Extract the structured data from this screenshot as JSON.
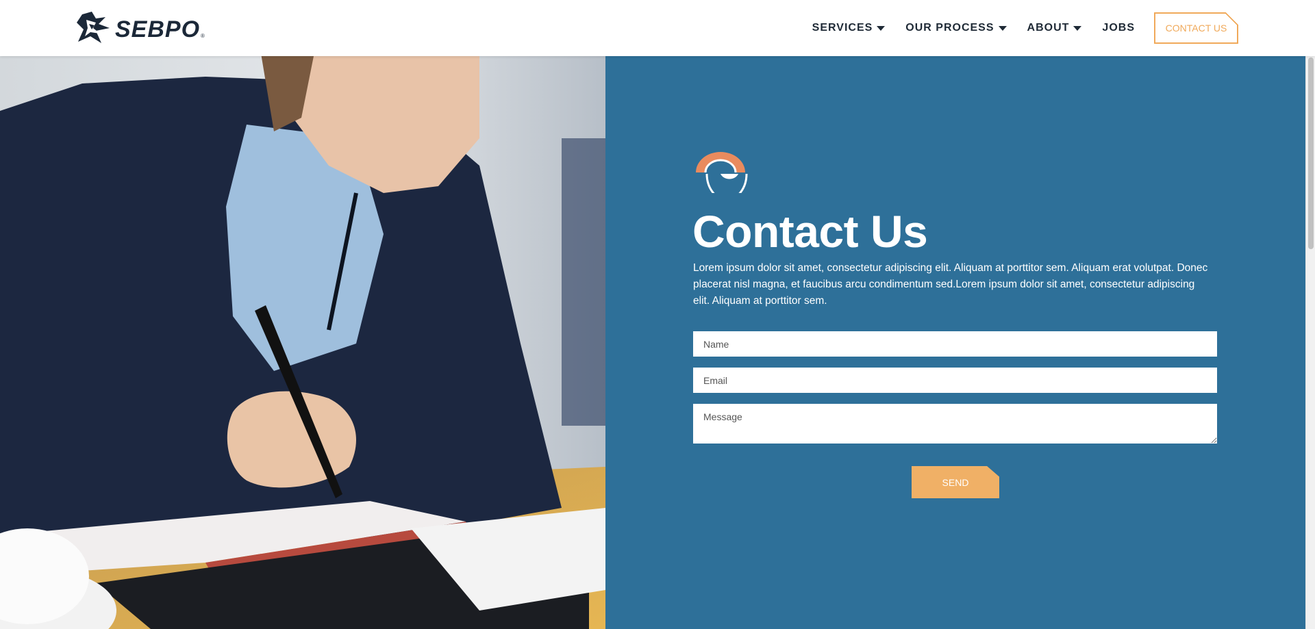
{
  "header": {
    "logo_text": "SEBPO",
    "logo_reg": "®",
    "nav": [
      {
        "label": "SERVICES",
        "has_dropdown": true
      },
      {
        "label": "OUR PROCESS",
        "has_dropdown": true
      },
      {
        "label": "ABOUT",
        "has_dropdown": true
      },
      {
        "label": "JOBS",
        "has_dropdown": false
      }
    ],
    "contact_button": "CONTACT US"
  },
  "hero": {
    "image": "woman-writing-in-notebook"
  },
  "contact": {
    "title": "Contact Us",
    "description": "Lorem ipsum dolor sit amet, consectetur adipiscing elit. Aliquam at porttitor sem. Aliquam erat volutpat. Donec placerat nisl magna, et faucibus arcu condimentum sed.Lorem ipsum dolor sit amet, consectetur adipiscing elit. Aliquam at porttitor sem.",
    "name_placeholder": "Name",
    "email_placeholder": "Email",
    "message_placeholder": "Message",
    "send_label": "SEND"
  },
  "colors": {
    "panel": "#2e7099",
    "accent": "#f0a95a",
    "nav_text": "#1f2a36"
  }
}
